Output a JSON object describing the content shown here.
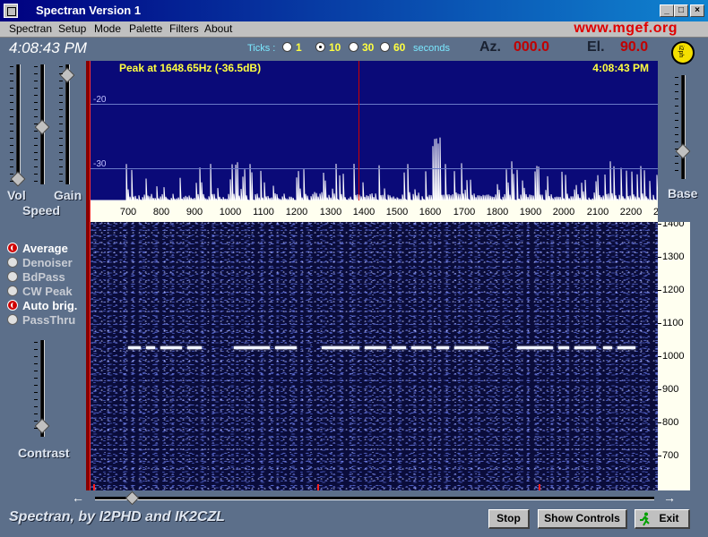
{
  "window": {
    "title": "Spectran Version 1",
    "buttons": [
      "_",
      "□",
      "×"
    ]
  },
  "menu": {
    "items": [
      "Spectran",
      "Setup",
      "Mode",
      "Palette",
      "Filters",
      "About"
    ],
    "site_url": "www.mgef.org"
  },
  "status": {
    "clock": "4:08:43 PM",
    "ticks_label": "Ticks :",
    "tick_options": [
      "1",
      "10",
      "30",
      "60"
    ],
    "tick_selected": "10",
    "seconds_label": "seconds",
    "az_label": "Az.",
    "az_value": "000.0",
    "el_label": "El.",
    "el_value": "90.0"
  },
  "sliders": {
    "vol_label": "Vol",
    "gain_label": "Gain",
    "speed_label": "Speed",
    "contrast_label": "Contrast",
    "base_label": "Base"
  },
  "options": [
    {
      "label": "Average",
      "on": true
    },
    {
      "label": "Denoiser",
      "on": false
    },
    {
      "label": "BdPass",
      "on": false
    },
    {
      "label": "CW Peak",
      "on": false
    },
    {
      "label": "Auto brig.",
      "on": true
    },
    {
      "label": "PassThru",
      "on": false
    }
  ],
  "spectrum": {
    "peak_text": "Peak at  1648.65Hz (-36.5dB)",
    "time": "4:08:43 PM",
    "db_labels": [
      "-20",
      "-30"
    ],
    "freq_ticks": [
      "700",
      "800",
      "900",
      "1000",
      "1100",
      "1200",
      "1300",
      "1400",
      "1500",
      "1600",
      "1700",
      "1800",
      "1900",
      "2000",
      "2100",
      "2200",
      "2"
    ]
  },
  "waterfall": {
    "hz_ticks": [
      "1400",
      "1300",
      "1200",
      "1100",
      "1000",
      "900",
      "800",
      "700"
    ]
  },
  "footer": {
    "credits": "Spectran, by I2PHD and IK2CZL",
    "stop_label": "Stop",
    "show_controls_label": "Show Controls",
    "exit_label": "Exit"
  },
  "colors": {
    "spectrum_bg": "#0a0a78",
    "peak_text": "#ffff40",
    "accent_red": "#c00000",
    "panel": "#5c6f8a"
  }
}
